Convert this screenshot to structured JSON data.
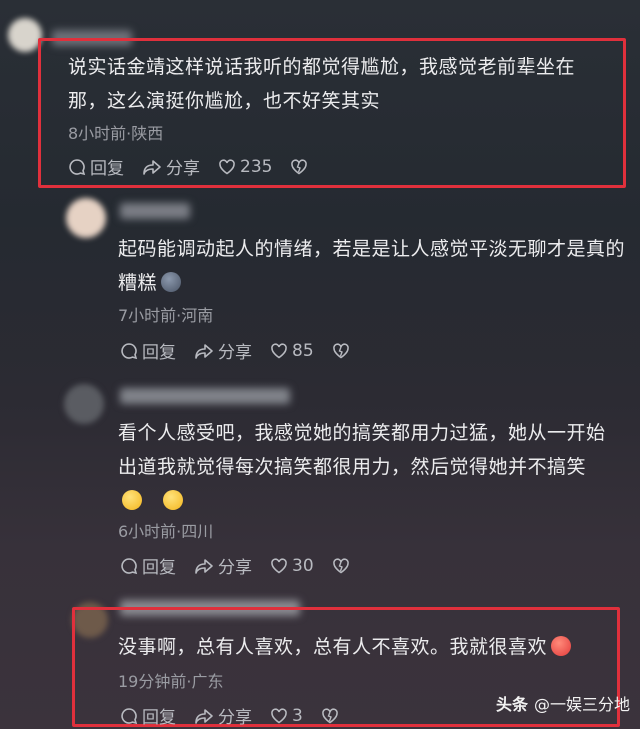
{
  "comments": [
    {
      "text_lines": [
        "说实话金靖这样说话我听的都觉得尴尬，我感觉老前辈坐在",
        "那，这么演挺你尴尬，也不好笑其实"
      ],
      "meta": "8小时前·陕西",
      "reply": "回复",
      "share": "分享",
      "likes": "235"
    },
    {
      "text_lines": [
        "起码能调动起人的情绪，若是是让人感觉平淡无聊才是真的",
        "糟糕"
      ],
      "meta": "7小时前·河南",
      "reply": "回复",
      "share": "分享",
      "likes": "85"
    },
    {
      "text_lines": [
        "看个人感受吧，我感觉她的搞笑都用力过猛，她从一开始",
        "出道我就觉得每次搞笑都很用力，然后觉得她并不搞笑"
      ],
      "meta": "6小时前·四川",
      "reply": "回复",
      "share": "分享",
      "likes": "30"
    },
    {
      "text_lines": [
        "没事啊，总有人喜欢，总有人不喜欢。我就很喜欢"
      ],
      "meta": "19分钟前·广东",
      "reply": "回复",
      "share": "分享",
      "likes": "3"
    }
  ],
  "watermark": {
    "brand": "头条",
    "account": "@一娱三分地"
  },
  "icons": [
    "reply-icon",
    "share-icon",
    "like-icon",
    "dislike-icon",
    "emoji-icon"
  ],
  "colors": {
    "highlight": "#e0303c",
    "background": "#2a2f36"
  }
}
